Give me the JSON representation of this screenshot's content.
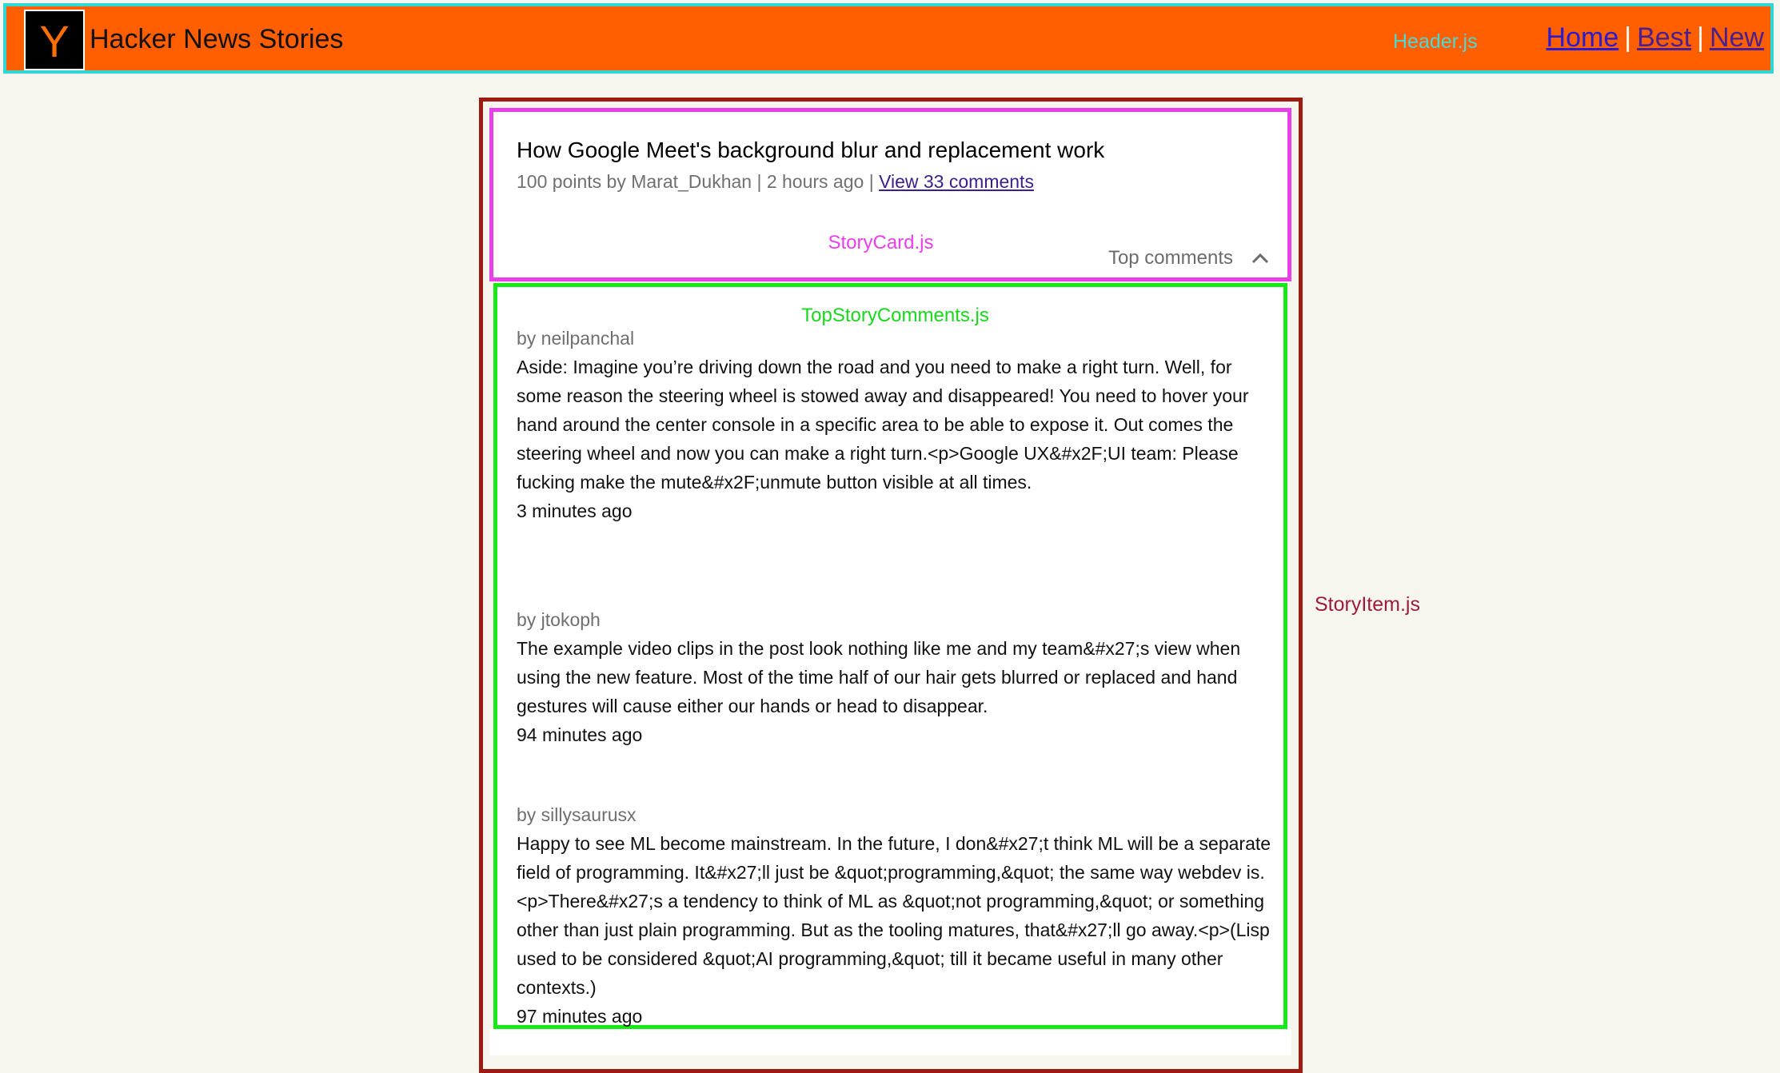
{
  "header": {
    "logo_letter": "Y",
    "title": "Hacker News Stories",
    "file_label": "Header.js",
    "nav": [
      {
        "label": "Home"
      },
      {
        "label": "Best"
      },
      {
        "label": "New"
      }
    ],
    "separator": "|"
  },
  "story_item": {
    "file_label": "StoryItem.js"
  },
  "story_card": {
    "title": "How Google Meet's background blur and replacement work",
    "meta_prefix": "100 points by Marat_Dukhan | 2 hours ago |",
    "comments_link": "View 33 comments",
    "file_label": "StoryCard.js",
    "toggle_label": "Top comments"
  },
  "top_comments": {
    "file_label": "TopStoryComments.js",
    "items": [
      {
        "by": "by neilpanchal",
        "text": "Aside: Imagine you’re driving down the road and you need to make a right turn. Well, for some reason the steering wheel is stowed away and disappeared! You need to hover your hand around the center console in a specific area to be able to expose it. Out comes the steering wheel and now you can make a right turn.<p>Google UX&#x2F;UI team: Please fucking make the mute&#x2F;unmute button visible at all times.",
        "time": "3 minutes ago"
      },
      {
        "by": "by jtokoph",
        "text": "The example video clips in the post look nothing like me and my team&#x27;s view when using the new feature. Most of the time half of our hair gets blurred or replaced and hand gestures will cause either our hands or head to disappear.",
        "time": "94 minutes ago"
      },
      {
        "by": "by sillysaurusx",
        "text": "Happy to see ML become mainstream. In the future, I don&#x27;t think ML will be a separate field of programming. It&#x27;ll just be &quot;programming,&quot; the same way webdev is.<p>There&#x27;s a tendency to think of ML as &quot;not programming,&quot; or something other than just plain programming. But as the tooling matures, that&#x27;ll go away.<p>(Lisp used to be considered &quot;AI programming,&quot; till it became useful in many other contexts.)",
        "time": "97 minutes ago"
      }
    ]
  },
  "colors": {
    "header_bg": "#ff5f00",
    "header_outline": "#2fd6d3",
    "story_item_outline": "#9e1b14",
    "story_card_outline": "#e83fe8",
    "comments_outline": "#17e81a",
    "page_bg": "#f6f6ef"
  }
}
